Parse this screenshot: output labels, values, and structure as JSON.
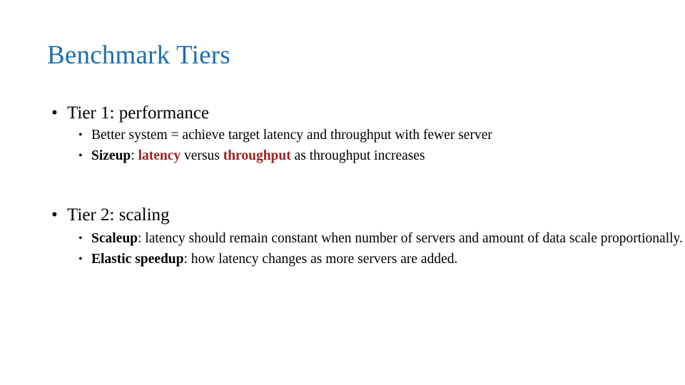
{
  "slide": {
    "title": "Benchmark Tiers",
    "title_color": "#1b6eb0",
    "body_color": "#000000",
    "highlight_color": "#9c2123",
    "background_color": "#ffffff",
    "bullet_glyph_level1": "•",
    "bullet_glyph_level2": "•"
  },
  "tiers": [
    {
      "heading": "Tier 1: performance",
      "items": [
        {
          "id": "better-system",
          "plain": "Better system = achieve target latency and throughput with fewer server",
          "runs": [
            {
              "text": "Better system = achieve target latency and throughput with fewer server",
              "style": "normal"
            }
          ]
        },
        {
          "id": "sizeup",
          "plain": "Sizeup: latency versus throughput as throughput increases",
          "runs": [
            {
              "text": "Sizeup",
              "style": "bold"
            },
            {
              "text": ": ",
              "style": "normal"
            },
            {
              "text": "latency",
              "style": "highlight"
            },
            {
              "text": " versus ",
              "style": "normal"
            },
            {
              "text": "throughput",
              "style": "highlight"
            },
            {
              "text": " as throughput increases",
              "style": "normal"
            }
          ]
        }
      ]
    },
    {
      "heading": "Tier 2: scaling",
      "items": [
        {
          "id": "scaleup",
          "plain": "Scaleup: latency should remain constant when number of servers and amount of data scale proportionally.",
          "runs": [
            {
              "text": "Scaleup",
              "style": "bold"
            },
            {
              "text": ": latency should remain constant when number of servers and amount of data scale proportionally.",
              "style": "normal"
            }
          ]
        },
        {
          "id": "elastic-speedup",
          "plain": "Elastic speedup: how latency changes as more servers are added.",
          "runs": [
            {
              "text": "Elastic speedup",
              "style": "bold"
            },
            {
              "text": ": how latency changes as more servers are added.",
              "style": "normal"
            }
          ]
        }
      ]
    }
  ]
}
